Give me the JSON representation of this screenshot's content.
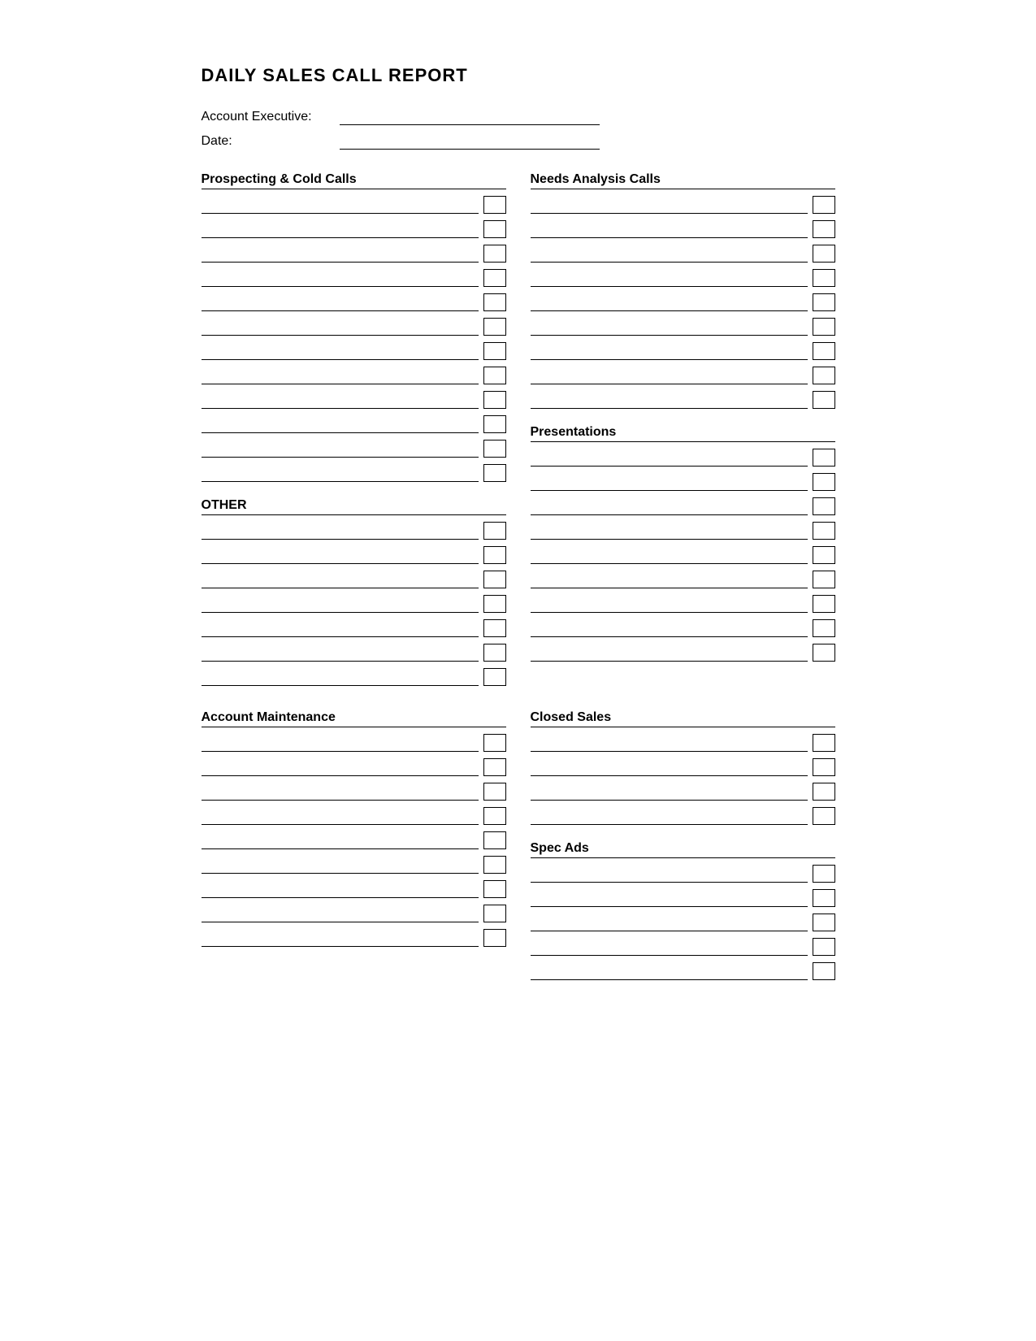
{
  "title": "DAILY SALES CALL REPORT",
  "fields": {
    "account_executive_label": "Account Executive:",
    "date_label": "Date:"
  },
  "sections": {
    "prospecting": {
      "title": "Prospecting & Cold Calls",
      "rows": 12
    },
    "other": {
      "title": "OTHER",
      "rows": 7
    },
    "needs_analysis": {
      "title": "Needs Analysis Calls",
      "rows": 9
    },
    "presentations": {
      "title": "Presentations",
      "rows": 9
    },
    "account_maintenance": {
      "title": "Account Maintenance",
      "rows": 9
    },
    "closed_sales": {
      "title": "Closed Sales",
      "rows": 4
    },
    "spec_ads": {
      "title": "Spec Ads",
      "rows": 5
    }
  }
}
